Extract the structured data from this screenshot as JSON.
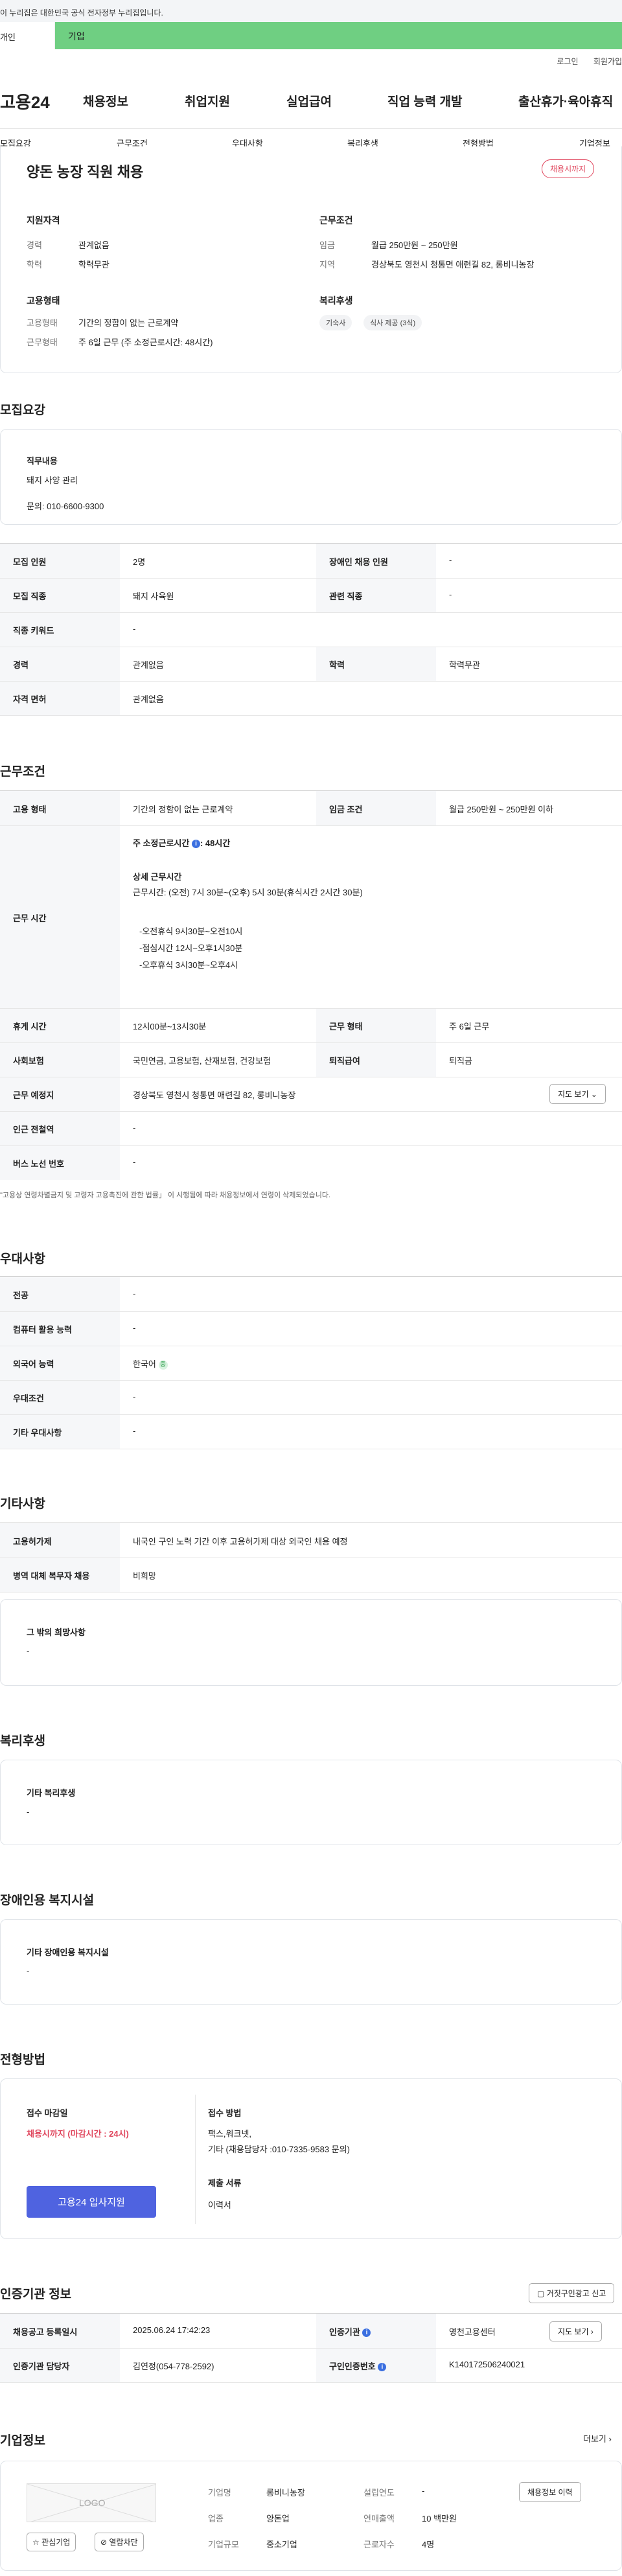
{
  "topbar": {
    "notice": "이 누리집은 대한민국 공식 전자정부 누리집입니다."
  },
  "govband": {
    "left": "개인",
    "right": "기업"
  },
  "toplinks": {
    "login": "로그인",
    "signup": "회원가입"
  },
  "logo": "고용24",
  "nav": [
    "채용정보",
    "취업지원",
    "실업급여",
    "직업 능력 개발",
    "출산휴가·육아휴직"
  ],
  "subnav": [
    "모집요강",
    "근무조건",
    "우대사항",
    "복리후생",
    "전형방법",
    "기업정보"
  ],
  "summary": {
    "title": "양돈 농장 직원 채용",
    "badge": "채용시까지",
    "qual_title": "지원자격",
    "cond_title": "근무조건",
    "career_l": "경력",
    "career_v": "관계없음",
    "edu_l": "학력",
    "edu_v": "학력무관",
    "pay_l": "임금",
    "pay_v": "월급 250만원 ~ 250만원",
    "area_l": "지역",
    "area_v": "경상북도 영천시 청통면 애련길 82, 롱비니농장",
    "emp_title": "고용형태",
    "welfare_title": "복리후생",
    "type_l": "고용형태",
    "type_v": "기간의 정함이 없는 근로계약",
    "work_l": "근무형태",
    "work_v": "주 6일 근무 (주 소정근로시간: 48시간)",
    "chips": [
      "기숙사",
      "식사 제공 (3식)"
    ]
  },
  "recruit": {
    "title": "모집요강",
    "duty_title": "직무내용",
    "duty_text": "돼지 사양 관리",
    "inquiry": "문의:  010-6600-9300",
    "rows": [
      {
        "k1": "모집 인원",
        "v1": "2명",
        "k2": "장애인 채용 인원",
        "v2": "-"
      },
      {
        "k1": "모집 직종",
        "v1": "돼지 사육원",
        "k2": "관련 직종",
        "v2": "-"
      },
      {
        "k1": "직종 키워드",
        "v1": "-"
      },
      {
        "k1": "경력",
        "v1": "관계없음",
        "k2": "학력",
        "v2": "학력무관"
      },
      {
        "k1": "자격 면허",
        "v1": "관계없음"
      }
    ]
  },
  "cond": {
    "title": "근무조건",
    "type_k": "고용 형태",
    "type_v": "기간의 정함이 없는 근로계약",
    "pay_k": "임금 조건",
    "pay_v": "월급 250만원 ~ 250만원 이하",
    "hours_k": "근무 시간",
    "weekly_label": "주 소정근로시간",
    "weekly_val": ": 48시간",
    "detail_title": "상세 근무시간",
    "detail_text": "근무시간: (오전) 7시 30분~(오후) 5시 30분(휴식시간 2시간 30분)",
    "breaks": [
      "-오전휴식 9시30분~오전10시",
      "-점심시간 12시~오후1시30분",
      "-오후휴식 3시30분~오후4시"
    ],
    "rest_k": "휴게 시간",
    "rest_v": "12시00분~13시30분",
    "form_k": "근무 형태",
    "form_v": "주 6일 근무",
    "ins_k": "사회보험",
    "ins_v": "국민연금, 고용보험, 산재보험, 건강보험",
    "sev_k": "퇴직급여",
    "sev_v": "퇴직금",
    "place_k": "근무 예정지",
    "place_v": "경상북도 영천시 청통면 애련길 82, 롱비니농장",
    "map_btn": "지도 보기",
    "station_k": "인근 전철역",
    "station_v": "-",
    "bus_k": "버스 노선 번호",
    "bus_v": "-",
    "note": "\"고용상 연령차별금지 및 고령자 고용촉진에 관한 법률」 이 시행됨에 따라 채용정보에서 연령이 삭제되었습니다."
  },
  "pref": {
    "title": "우대사항",
    "rows": [
      {
        "k": "전공",
        "v": "-"
      },
      {
        "k": "컴퓨터 활용 능력",
        "v": "-"
      },
      {
        "k": "외국어 능력",
        "v": "한국어"
      },
      {
        "k": "우대조건",
        "v": "-"
      },
      {
        "k": "기타 우대사항",
        "v": "-"
      }
    ],
    "lang_mark": "중"
  },
  "etc": {
    "title": "기타사항",
    "rows": [
      {
        "k": "고용허가제",
        "v": "내국인 구인 노력 기간 이후 고용허가제 대상 외국인 채용 예정"
      },
      {
        "k": "병역 대체 복무자 채용",
        "v": "비희망"
      }
    ],
    "hope_title": "그 밖의 희망사항",
    "hope_val": "-"
  },
  "welfare": {
    "title": "복리후생",
    "box_title": "기타 복리후생",
    "box_val": "-"
  },
  "disabled": {
    "title": "장애인용 복지시설",
    "box_title": "기타 장애인용 복지시설",
    "box_val": "-"
  },
  "selection": {
    "title": "전형방법",
    "deadline_title": "접수 마감일",
    "deadline_val": "채용시까지 (마감시간 : 24시)",
    "apply_btn": "고용24 입사지원",
    "method_title": "접수 방법",
    "method_text1": "팩스,워크넷,",
    "method_text2": "기타 (채용담당자 :010-7335-9583 문의)",
    "docs_title": "제출 서류",
    "docs_val": "이력서"
  },
  "cert": {
    "title": "인증기관 정보",
    "report_btn": "거짓구인광고 신고",
    "reg_k": "채용공고 등록일시",
    "reg_v": "2025.06.24 17:42:23",
    "agency_k": "인증기관",
    "agency_v": "영천고용센터",
    "map_btn": "지도 보기",
    "mgr_k": "인증기관 담당자",
    "mgr_v": "김연정(054-778-2592)",
    "no_k": "구인인증번호",
    "no_v": "K140172506240021"
  },
  "company": {
    "title": "기업정보",
    "more": "더보기",
    "logo_text": "LOGO",
    "fav_btn": "관심기업",
    "block_btn": "열람차단",
    "name_k": "기업명",
    "name_v": "롱비니농장",
    "year_k": "설립연도",
    "year_v": "-",
    "ind_k": "업종",
    "ind_v": "양돈업",
    "sales_k": "연매출액",
    "sales_v": "10 백만원",
    "size_k": "기업규모",
    "size_v": "중소기업",
    "emp_k": "근로자수",
    "emp_v": "4명",
    "history_btn": "채용정보 이력"
  }
}
